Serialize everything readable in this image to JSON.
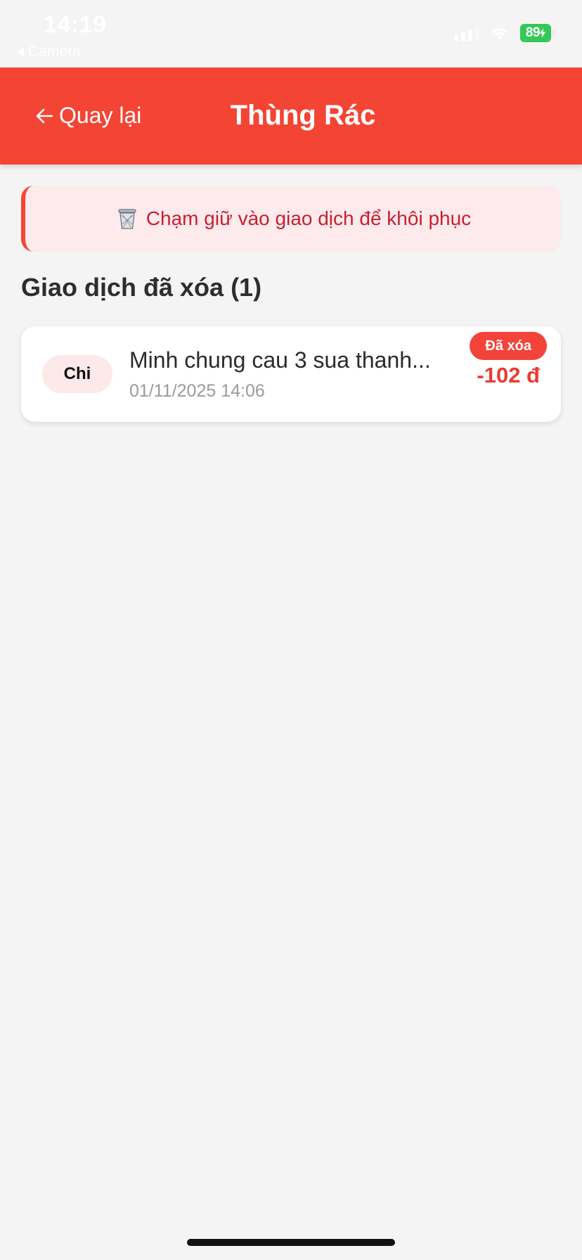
{
  "status_bar": {
    "time": "14:19",
    "back_app": "Camera",
    "battery": "89"
  },
  "header": {
    "back_label": "Quay lại",
    "title": "Thùng Rác"
  },
  "info_banner": {
    "icon": "wastebasket-icon",
    "text": "Chạm giữ vào giao dịch để khôi phục"
  },
  "section": {
    "title": "Giao dịch đã xóa (1)"
  },
  "transactions": [
    {
      "type": "Chi",
      "description": "Minh chung cau 3 sua thanh...",
      "datetime": "01/11/2025 14:06",
      "badge": "Đã xóa",
      "amount": "-102 đ"
    }
  ],
  "colors": {
    "header_bg": "#f44434",
    "banner_bg": "#fdeaec",
    "banner_text": "#c8202e",
    "amount": "#ea3b32",
    "badge_bg": "#f2443a"
  }
}
